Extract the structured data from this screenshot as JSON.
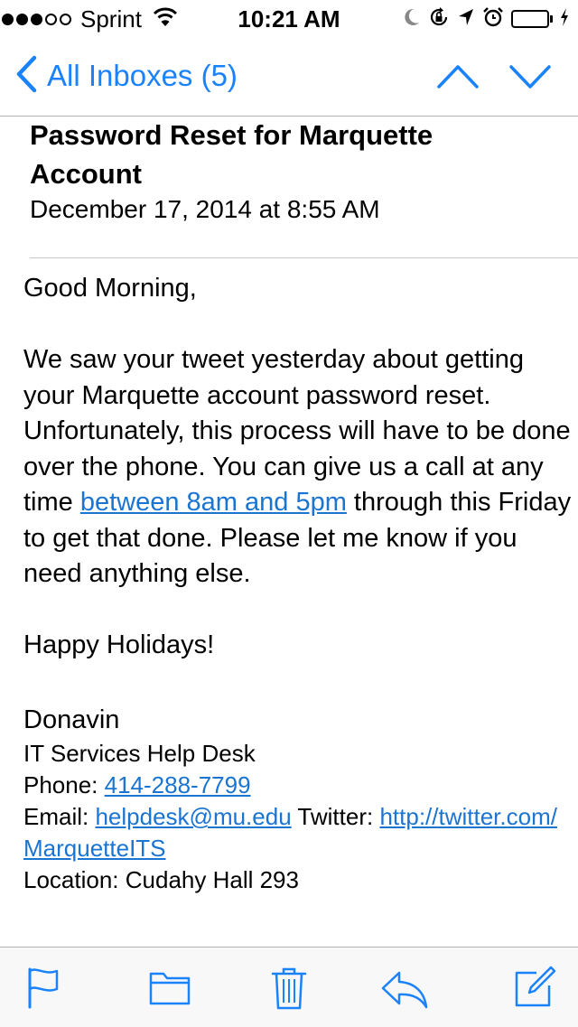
{
  "status": {
    "carrier": "Sprint",
    "time": "10:21 AM",
    "signal_full": 3,
    "signal_total": 5
  },
  "nav": {
    "back_label": "All Inboxes (5)"
  },
  "message": {
    "subject": "Password Reset for Marquette Account",
    "date": "December 17, 2014 at 8:55 AM",
    "greeting": "Good Morning,",
    "para_before_link": "We saw your tweet yesterday about getting your Marquette account password reset. Unfortunately, this process will have to be done over the phone. You can give us a call at any time ",
    "para_link": "between 8am and 5pm",
    "para_after_link": " through this Friday to get that done. Please let me know if you need anything else.",
    "closing": "Happy Holidays!",
    "signature": {
      "name": "Donavin",
      "department": "IT Services Help Desk",
      "phone_label": "Phone: ",
      "phone": "414-288-7799",
      "email_label": "Email: ",
      "email": "helpdesk@mu.edu",
      "twitter_label": " Twitter: ",
      "twitter": "http://twitter.com/MarquetteITS",
      "location": "Location: Cudahy Hall 293"
    }
  },
  "colors": {
    "accent": "#1a82fb",
    "link": "#1a74d1",
    "battery": "#4cd964"
  },
  "icons": [
    "signal-dots",
    "wifi-icon",
    "moon-icon",
    "rotation-lock-icon",
    "location-arrow-icon",
    "alarm-icon",
    "battery-icon",
    "charging-bolt-icon",
    "chevron-left-icon",
    "chevron-up-icon",
    "chevron-down-icon",
    "flag-icon",
    "folder-icon",
    "trash-icon",
    "reply-icon",
    "compose-icon"
  ]
}
